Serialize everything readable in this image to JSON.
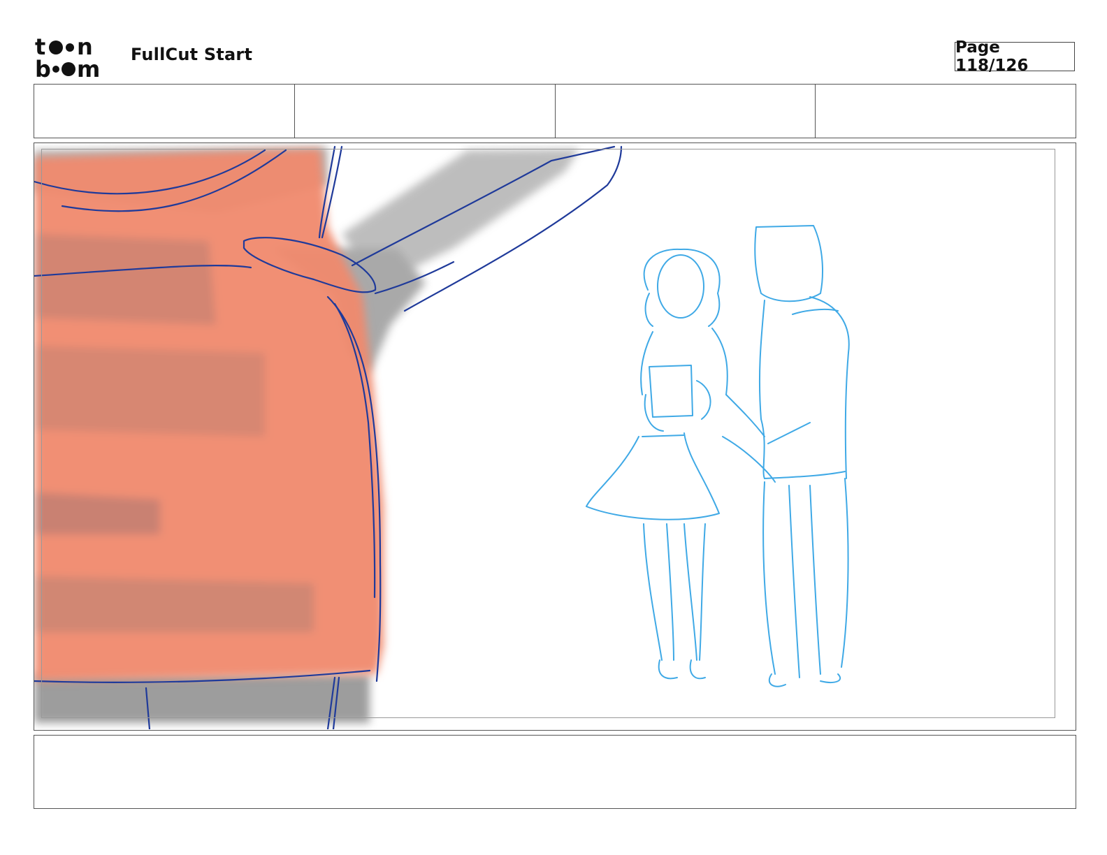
{
  "header": {
    "logo_text": "toon boom",
    "project_title": "FullCut Start",
    "page_indicator": "Page 118/126"
  },
  "info_row": {
    "cells": [
      "",
      "",
      "",
      ""
    ]
  },
  "panel": {
    "colors": {
      "foreground_fill": "#f0896d",
      "shadow": "#9a9a9a",
      "foreground_line": "#1f3a9a",
      "background_sketch": "#3fa9e6"
    }
  },
  "caption": {
    "text": ""
  }
}
